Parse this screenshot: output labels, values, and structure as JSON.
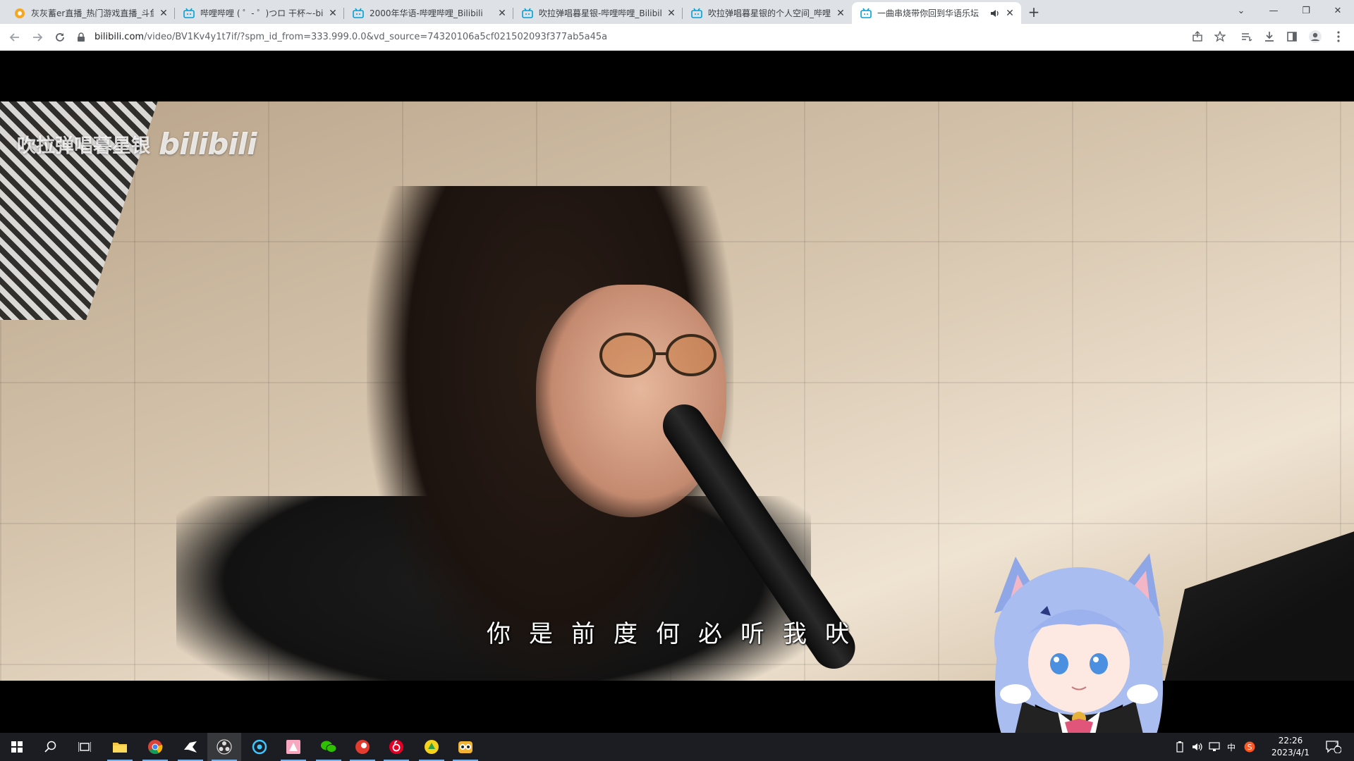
{
  "browser": {
    "tabs": [
      {
        "title": "灰灰蓄er直播_热门游戏直播_斗鱼",
        "favicon": "douyu-icon",
        "active": false
      },
      {
        "title": "哔哩哔哩 ( ゜- ゜)つロ 干杯~-bilibili",
        "favicon": "bilibili-icon",
        "active": false
      },
      {
        "title": "2000年华语-哔哩哔哩_Bilibili",
        "favicon": "bilibili-icon",
        "active": false
      },
      {
        "title": "吹拉弹唱暮星银-哔哩哔哩_Bilibili",
        "favicon": "bilibili-icon",
        "active": false
      },
      {
        "title": "吹拉弹唱暮星银的个人空间_哔哩",
        "favicon": "bilibili-icon",
        "active": false
      },
      {
        "title": "一曲串烧带你回到华语乐坛",
        "favicon": "bilibili-icon",
        "active": true,
        "audio": true
      }
    ],
    "address": {
      "host": "bilibili.com",
      "path": "/video/BV1Kv4y1t7if/?spm_id_from=333.999.0.0&vd_source=74320106a5cf021502093f377ab5a45a"
    }
  },
  "video": {
    "watermark_text": "吹拉弹唱暮星银",
    "watermark_logo": "bilibili",
    "subtitle": "你是前度何必听我吠"
  },
  "taskbar": {
    "apps": [
      "start-icon",
      "search-icon",
      "task-view-icon",
      "file-explorer-icon",
      "chrome-icon",
      "app-bird-icon",
      "obs-icon",
      "app-blue-icon",
      "app-pink-icon",
      "wechat-icon",
      "app-red-icon",
      "netease-music-icon",
      "app-yellow-icon",
      "app-owl-icon"
    ],
    "ime": "中",
    "time": "22:26",
    "date": "2023/4/1",
    "notification_count": "2"
  },
  "colors": {
    "tabstrip": "#dee1e6",
    "taskbar": "#1c1d22",
    "bilibili_blue": "#00a1d6"
  }
}
